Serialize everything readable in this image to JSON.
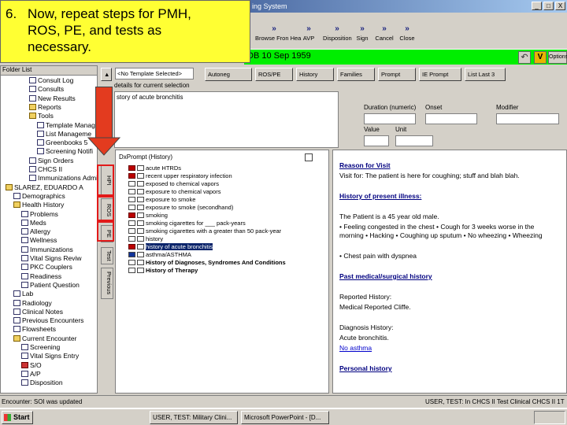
{
  "window": {
    "title": "ing System",
    "controls": [
      "_",
      "□",
      "X"
    ]
  },
  "callout": {
    "number": "6.",
    "lines": [
      "Now, repeat steps for PMH,",
      "ROS, PE, and tests as",
      "necessary."
    ]
  },
  "toolbar": {
    "buttons": [
      {
        "glyph": "»",
        "label": "Browse Fron Hea"
      },
      {
        "glyph": "»",
        "label": "AVP"
      },
      {
        "glyph": "»",
        "label": "Disposition"
      },
      {
        "glyph": "»",
        "label": "Sign"
      },
      {
        "glyph": "»",
        "label": "Cancel"
      },
      {
        "glyph": "»",
        "label": "Close"
      }
    ],
    "right_buttons": [
      "Options"
    ]
  },
  "patient": {
    "dob": "DB 10 Sep 1959",
    "bar_color": "#00ee00"
  },
  "folder": {
    "header": "Folder List",
    "items": [
      "Consult Log",
      "Consults",
      "New Results",
      "Reports",
      "Tools",
      "Template Manag",
      "List Manageme",
      "Greenbooks 5",
      "Screening Notifi",
      "Sign Orders",
      "CHCS II",
      "Immunizations Admi",
      "SLAREZ, EDUARDO A",
      "Demographics",
      "Health History",
      "Problems",
      "Meds",
      "Allergy",
      "Wellness",
      "Immunizations",
      "Vital Signs Reviw",
      "PKC Couplers",
      "Readiness",
      "Patient Question",
      "Lab",
      "Radiology",
      "Clinical Notes",
      "Previous Encounters",
      "Flowsheets",
      "Current Encounter",
      "Screening",
      "Vital Signs Entry",
      "S/O",
      "A/P",
      "Disposition"
    ]
  },
  "nav": {
    "selector": "<No Template Selected>",
    "buttons": [
      "Autoneg",
      "ROS/PE",
      "History",
      "Families",
      "Prompt",
      "IE Prompt",
      "List Last 3"
    ],
    "details_label": "details for current selection",
    "history_of": "story of acute bronchitis",
    "duration_label": "Duration (numeric)",
    "onset_label": "Onset",
    "modifier_label": "Modifier",
    "value_label": "Value",
    "unit_label": "Unit"
  },
  "tabs": [
    "HPI",
    "ROS",
    "PE",
    "Test",
    "Previous"
  ],
  "checklist": {
    "title": "DxPrompt (History)",
    "items": [
      {
        "text": "acute HTRDs",
        "box": "red"
      },
      {
        "text": "recent upper respiratory infection",
        "box": "red"
      },
      {
        "text": "exposed to chemical vapors",
        "box": "none"
      },
      {
        "text": "exposure to chemical vapors",
        "box": "none"
      },
      {
        "text": "exposure to smoke",
        "box": "none"
      },
      {
        "text": "exposure to smoke (secondhand)",
        "box": "none"
      },
      {
        "text": "smoking",
        "box": "red"
      },
      {
        "text": "smoking cigarettes for ___ pack-years",
        "box": "none"
      },
      {
        "text": "smoking cigarettes with a greater than 50 pack-year",
        "box": "none"
      },
      {
        "text": "history",
        "box": "none"
      },
      {
        "text": "history of acute bronchitis",
        "box": "red"
      },
      {
        "text": "asthma/ASTHMA",
        "box": "blue"
      },
      {
        "text": "History of Diagnoses, Syndromes And Conditions",
        "box": "none"
      },
      {
        "text": "History of Therapy",
        "box": "none"
      }
    ]
  },
  "note": {
    "reason_header": "Reason for Visit",
    "reason_text": "Visit for: The patient is here for coughing; stuff and blah blah.",
    "hpi_header": "History of present illness:",
    "hpi_text1": "The Patient is a 45 year old male.",
    "hpi_text2": "• Feeling congested in the chest • Cough for 3 weeks worse in the morning • Hacking • Coughing up sputum • No wheezing • Wheezing",
    "hpi_text3": "• Chest pain with dyspnea",
    "pmh_header": "Past medical/surgical history",
    "reported_label": "Reported History:",
    "reported_text": "Medical Reported Cliffe.",
    "dx_label": "Diagnosis History:",
    "dx_text": "Acute bronchitis.",
    "asthma_text": "No asthma",
    "personal_header": "Personal history"
  },
  "status": {
    "text": "Encounter: SOI was updated",
    "right": "USER, TEST: In CHCS II   Test Clinical CHCS II   1T"
  },
  "taskbar": {
    "start": "Start",
    "tasks": [
      "USER, TEST: Military Clini...",
      "Microsoft PowerPoint - [D..."
    ],
    "clock": ""
  }
}
